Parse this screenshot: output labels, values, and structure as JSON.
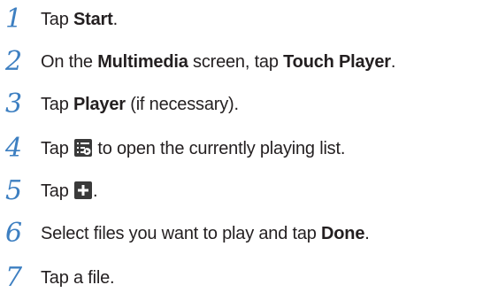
{
  "steps": [
    {
      "number": "1",
      "segments": [
        {
          "text": "Tap ",
          "bold": false
        },
        {
          "text": "Start",
          "bold": true
        },
        {
          "text": ".",
          "bold": false
        }
      ]
    },
    {
      "number": "2",
      "segments": [
        {
          "text": "On the ",
          "bold": false
        },
        {
          "text": "Multimedia",
          "bold": true
        },
        {
          "text": " screen, tap ",
          "bold": false
        },
        {
          "text": "Touch Player",
          "bold": true
        },
        {
          "text": ".",
          "bold": false
        }
      ]
    },
    {
      "number": "3",
      "segments": [
        {
          "text": "Tap ",
          "bold": false
        },
        {
          "text": "Player",
          "bold": true
        },
        {
          "text": " (if necessary).",
          "bold": false
        }
      ]
    },
    {
      "number": "4",
      "segments": [
        {
          "text": "Tap ",
          "bold": false
        },
        {
          "icon": "playlist-icon"
        },
        {
          "text": " to open the currently playing list.",
          "bold": false
        }
      ]
    },
    {
      "number": "5",
      "segments": [
        {
          "text": "Tap ",
          "bold": false
        },
        {
          "icon": "add-icon"
        },
        {
          "text": ".",
          "bold": false
        }
      ]
    },
    {
      "number": "6",
      "segments": [
        {
          "text": "Select files you want to play and tap ",
          "bold": false
        },
        {
          "text": "Done",
          "bold": true
        },
        {
          "text": ".",
          "bold": false
        }
      ]
    },
    {
      "number": "7",
      "segments": [
        {
          "text": "Tap a file.",
          "bold": false
        }
      ]
    }
  ],
  "colors": {
    "step_number": "#3d7fc1",
    "body_text": "#231f20"
  }
}
